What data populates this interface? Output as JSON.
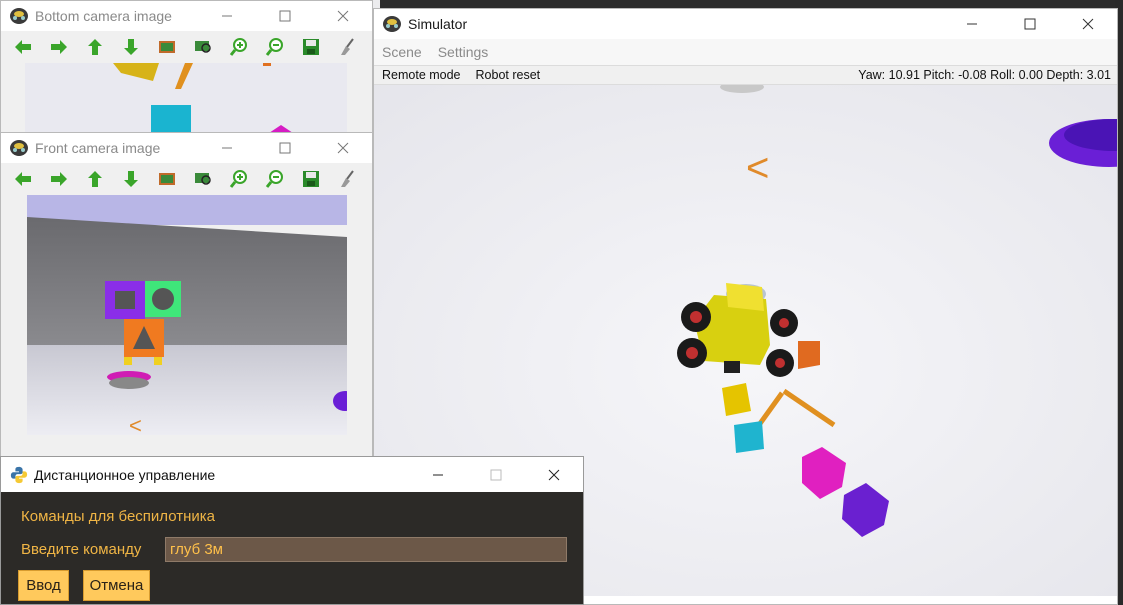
{
  "bottom_camera": {
    "title": "Bottom camera image"
  },
  "front_camera": {
    "title": "Front camera image",
    "scene_glyph": "<"
  },
  "toolbar": {
    "icons": [
      "arrow-left-icon",
      "arrow-right-icon",
      "arrow-up-icon",
      "arrow-down-icon",
      "image-icon",
      "zoom-fit-icon",
      "zoom-in-icon",
      "zoom-out-icon",
      "save-icon",
      "clear-icon"
    ]
  },
  "simulator": {
    "title": "Simulator",
    "menu": [
      "Scene",
      "Settings"
    ],
    "status_buttons": [
      "Remote mode",
      "Robot reset"
    ],
    "telemetry": "Yaw: 10.91 Pitch: -0.08 Roll: 0.00 Depth: 3.01",
    "scene_glyph": "<"
  },
  "remote_dialog": {
    "title": "Дистанционное управление",
    "heading": "Команды для беспилотника",
    "input_label": "Введите команду",
    "input_value": "глуб 3м",
    "submit_label": "Ввод",
    "cancel_label": "Отмена"
  },
  "colors": {
    "dialog_bg": "#2c2a27",
    "dialog_text": "#f0b545",
    "dialog_button": "#ffc95c",
    "input_bg": "#6c5848"
  }
}
